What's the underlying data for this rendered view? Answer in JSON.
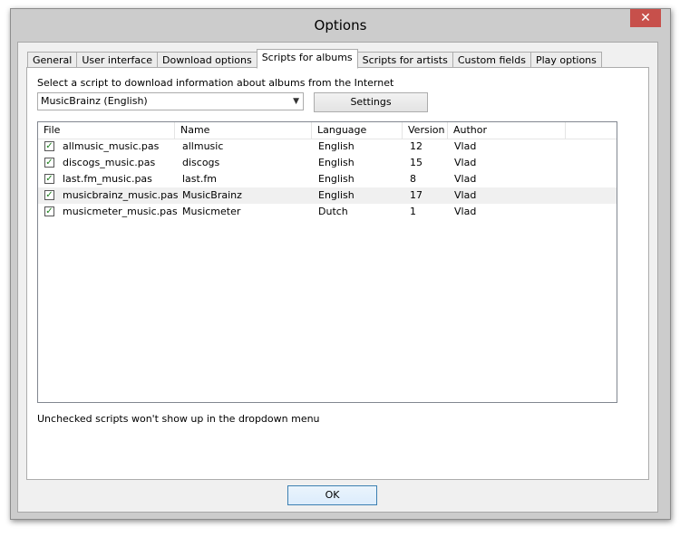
{
  "window": {
    "title": "Options",
    "close_glyph": "✕"
  },
  "tabs": [
    {
      "label": "General",
      "active": false
    },
    {
      "label": "User interface",
      "active": false
    },
    {
      "label": "Download options",
      "active": false
    },
    {
      "label": "Scripts for albums",
      "active": true
    },
    {
      "label": "Scripts for artists",
      "active": false
    },
    {
      "label": "Custom fields",
      "active": false
    },
    {
      "label": "Play options",
      "active": false
    }
  ],
  "panel": {
    "prompt": "Select a script to download information about albums from the Internet",
    "script_select": {
      "value": "MusicBrainz (English)",
      "arrow": "▼"
    },
    "settings_label": "Settings",
    "columns": [
      "File",
      "Name",
      "Language",
      "Version",
      "Author"
    ],
    "rows": [
      {
        "checked": true,
        "file": "allmusic_music.pas",
        "name": "allmusic",
        "language": "English",
        "version": "12",
        "author": "Vlad"
      },
      {
        "checked": true,
        "file": "discogs_music.pas",
        "name": "discogs",
        "language": "English",
        "version": "15",
        "author": "Vlad"
      },
      {
        "checked": true,
        "file": "last.fm_music.pas",
        "name": "last.fm",
        "language": "English",
        "version": "8",
        "author": "Vlad"
      },
      {
        "checked": true,
        "file": "musicbrainz_music.pas",
        "name": "MusicBrainz",
        "language": "English",
        "version": "17",
        "author": "Vlad",
        "selected": true
      },
      {
        "checked": true,
        "file": "musicmeter_music.pas",
        "name": "Musicmeter",
        "language": "Dutch",
        "version": "1",
        "author": "Vlad"
      }
    ],
    "check_glyph": "✓",
    "note": "Unchecked scripts won't show up in the dropdown menu"
  },
  "footer": {
    "ok_label": "OK"
  }
}
